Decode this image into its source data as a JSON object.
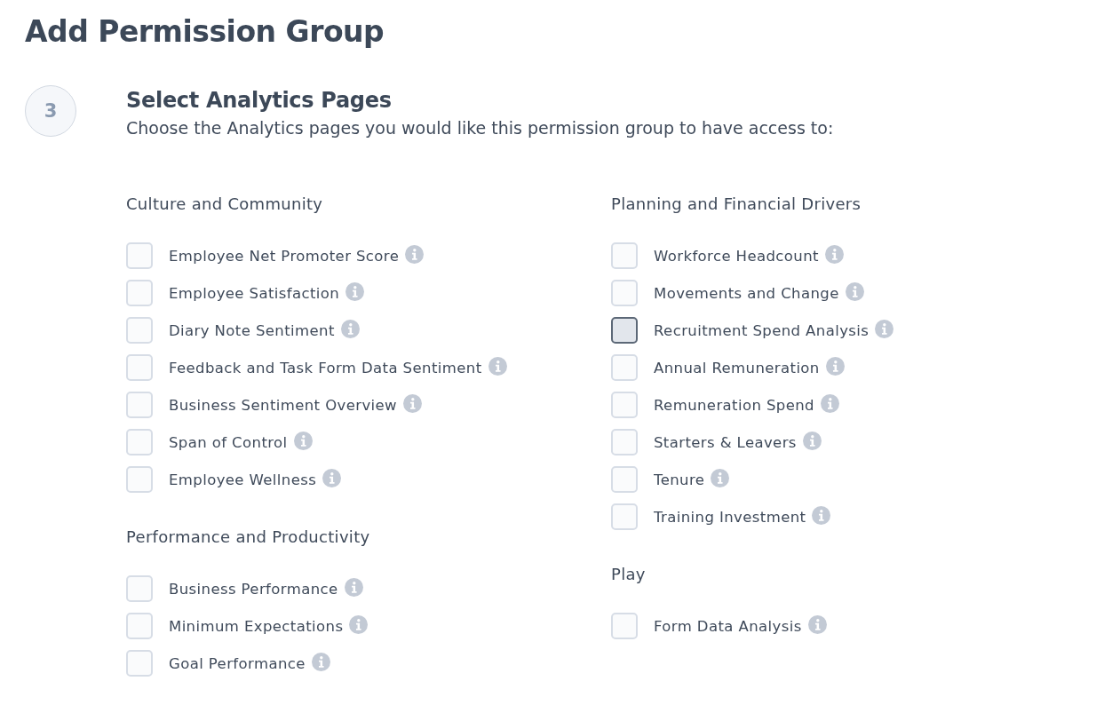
{
  "page_title": "Add Permission Group",
  "step": {
    "number": "3",
    "title": "Select Analytics Pages",
    "description": "Choose the Analytics pages you would like this permission group to have access to:"
  },
  "columns": [
    {
      "groups": [
        {
          "title": "Culture and Community",
          "items": [
            {
              "label": "Employee Net Promoter Score",
              "checked": false,
              "focused": false
            },
            {
              "label": "Employee Satisfaction",
              "checked": false,
              "focused": false
            },
            {
              "label": "Diary Note Sentiment",
              "checked": false,
              "focused": false
            },
            {
              "label": "Feedback and Task Form Data Sentiment",
              "checked": false,
              "focused": false
            },
            {
              "label": "Business Sentiment Overview",
              "checked": false,
              "focused": false
            },
            {
              "label": "Span of Control",
              "checked": false,
              "focused": false
            },
            {
              "label": "Employee Wellness",
              "checked": false,
              "focused": false
            }
          ]
        },
        {
          "title": "Performance and Productivity",
          "items": [
            {
              "label": "Business Performance",
              "checked": false,
              "focused": false
            },
            {
              "label": "Minimum Expectations",
              "checked": false,
              "focused": false
            },
            {
              "label": "Goal Performance",
              "checked": false,
              "focused": false
            }
          ]
        }
      ]
    },
    {
      "groups": [
        {
          "title": "Planning and Financial Drivers",
          "items": [
            {
              "label": "Workforce Headcount",
              "checked": false,
              "focused": false
            },
            {
              "label": "Movements and Change",
              "checked": false,
              "focused": false
            },
            {
              "label": "Recruitment Spend Analysis",
              "checked": false,
              "focused": true
            },
            {
              "label": "Annual Remuneration",
              "checked": false,
              "focused": false
            },
            {
              "label": "Remuneration Spend",
              "checked": false,
              "focused": false
            },
            {
              "label": "Starters & Leavers",
              "checked": false,
              "focused": false
            },
            {
              "label": "Tenure",
              "checked": false,
              "focused": false
            },
            {
              "label": "Training Investment",
              "checked": false,
              "focused": false
            }
          ]
        },
        {
          "title": "Play",
          "items": [
            {
              "label": "Form Data Analysis",
              "checked": false,
              "focused": false
            }
          ]
        }
      ]
    }
  ]
}
